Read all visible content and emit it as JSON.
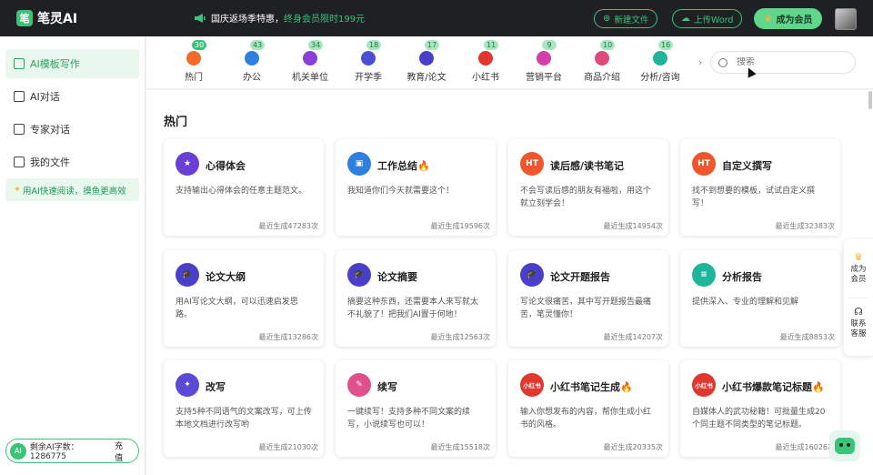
{
  "header": {
    "logo_text": "笔灵AI",
    "logo_glyph": "笔",
    "promo_white": "国庆返场季特惠，",
    "promo_green": "终身会员限时199元",
    "new_file": "新建文件",
    "upload_word": "上传Word",
    "become_vip": "成为会员"
  },
  "sidebar": {
    "items": [
      {
        "label": "AI模板写作"
      },
      {
        "label": "AI对话"
      },
      {
        "label": "专家对话"
      },
      {
        "label": "我的文件"
      }
    ],
    "promo": "用AI快速阅读，摸鱼更高效",
    "quota_label": "剩余AI字数：1286775",
    "quota_icon": "AI",
    "recharge": "充值"
  },
  "categories": [
    {
      "label": "热门",
      "count": "30",
      "color": "#f26b2b"
    },
    {
      "label": "办公",
      "count": "43",
      "color": "#2f7fe0"
    },
    {
      "label": "机关单位",
      "count": "34",
      "color": "#8a3fd6"
    },
    {
      "label": "开学季",
      "count": "18",
      "color": "#4a4fd6"
    },
    {
      "label": "教育/论文",
      "count": "17",
      "color": "#4a3fc9"
    },
    {
      "label": "小红书",
      "count": "11",
      "color": "#e0382f"
    },
    {
      "label": "营销平台",
      "count": "9",
      "color": "#d43fa9"
    },
    {
      "label": "商品介绍",
      "count": "10",
      "color": "#e04a7a"
    },
    {
      "label": "分析/咨询",
      "count": "16",
      "color": "#1fb59a"
    }
  ],
  "search": {
    "placeholder": "搜索"
  },
  "section_title": "热门",
  "cards": [
    {
      "title": "心得体会",
      "fire": "",
      "desc": "支持输出心得体会的任意主题范文。",
      "stat": "最近生成47283次",
      "icon": "star-icon",
      "color": "#6a3fd6",
      "glyph": "★"
    },
    {
      "title": "工作总结",
      "fire": "🔥",
      "desc": "我知道你们今天就需要这个！",
      "stat": "最近生成19596次",
      "icon": "briefcase-icon",
      "color": "#2f7fe0",
      "glyph": "▣"
    },
    {
      "title": "读后感/读书笔记",
      "fire": "",
      "desc": "不会写读后感的朋友有福啦，用这个就立刻学会！",
      "stat": "最近生成14954次",
      "icon": "hot-ht-icon",
      "color": "#f0562b",
      "glyph": "HT"
    },
    {
      "title": "自定义撰写",
      "fire": "",
      "desc": "找不到想要的模板，试试自定义撰写！",
      "stat": "最近生成32383次",
      "icon": "hot-ht-icon",
      "color": "#f0562b",
      "glyph": "HT"
    },
    {
      "title": "论文大纲",
      "fire": "",
      "desc": "用AI写论文大纲，可以迅速启发思路。",
      "stat": "最近生成13286次",
      "icon": "graduation-cap-icon",
      "color": "#4a3fc9",
      "glyph": "🎓"
    },
    {
      "title": "论文摘要",
      "fire": "",
      "desc": "摘要这种东西，还需要本人来写就太不礼貌了！把我们AI置于何地！",
      "stat": "最近生成12563次",
      "icon": "graduation-cap-icon",
      "color": "#4a3fc9",
      "glyph": "🎓"
    },
    {
      "title": "论文开题报告",
      "fire": "",
      "desc": "写论文很痛苦，其中写开题报告最痛苦，笔灵懂你！",
      "stat": "最近生成14207次",
      "icon": "graduation-cap-icon",
      "color": "#4a3fc9",
      "glyph": "🎓"
    },
    {
      "title": "分析报告",
      "fire": "",
      "desc": "提供深入、专业的理解和见解",
      "stat": "最近生成8853次",
      "icon": "document-icon",
      "color": "#1fb59a",
      "glyph": "≡"
    },
    {
      "title": "改写",
      "fire": "",
      "desc": "支持5种不同语气的文案改写，可上传本地文档进行改写哟",
      "stat": "最近生成21030次",
      "icon": "magic-wand-icon",
      "color": "#5a4ad6",
      "glyph": "✦"
    },
    {
      "title": "续写",
      "fire": "",
      "desc": "一键续写！支持多种不同文案的续写，小说续写也可以！",
      "stat": "最近生成15518次",
      "icon": "pen-icon",
      "color": "#e0508a",
      "glyph": "✎"
    },
    {
      "title": "小红书笔记生成",
      "fire": "🔥",
      "desc": "输入你想发布的内容，帮你生成小红书的风格。",
      "stat": "最近生成20335次",
      "icon": "xiaohongshu-icon",
      "color": "#e0382f",
      "glyph": "小红书"
    },
    {
      "title": "小红书爆款笔记标题",
      "fire": "🔥",
      "desc": "自媒体人的武功秘籍！可批量生成20个同主题不同类型的笔记标题。",
      "stat": "最近生成16026次",
      "icon": "xiaohongshu-icon",
      "color": "#e0382f",
      "glyph": "小红书"
    }
  ],
  "float": {
    "vip": "成为\n会员",
    "service": "联系\n客服"
  }
}
